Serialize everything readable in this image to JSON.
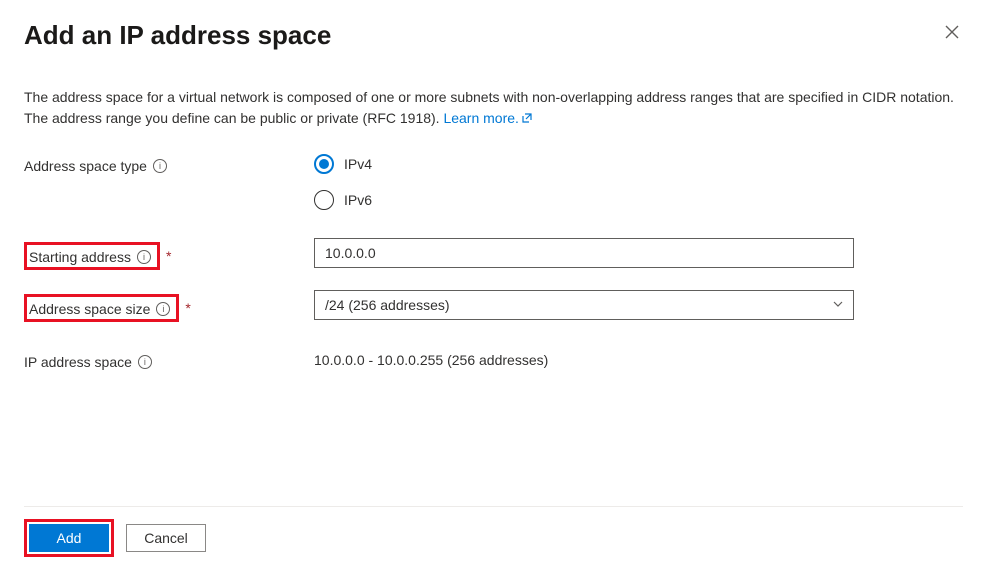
{
  "header": {
    "title": "Add an IP address space"
  },
  "description": {
    "text": "The address space for a virtual network is composed of one or more subnets with non-overlapping address ranges that are specified in CIDR notation. The address range you define can be public or private (RFC 1918). ",
    "learn_more": "Learn more."
  },
  "fields": {
    "address_space_type": {
      "label": "Address space type",
      "options": {
        "ipv4": "IPv4",
        "ipv6": "IPv6"
      },
      "selected": "ipv4"
    },
    "starting_address": {
      "label": "Starting address",
      "value": "10.0.0.0"
    },
    "address_space_size": {
      "label": "Address space size",
      "value": "/24 (256 addresses)"
    },
    "ip_address_space": {
      "label": "IP address space",
      "value": "10.0.0.0 - 10.0.0.255 (256 addresses)"
    }
  },
  "footer": {
    "add": "Add",
    "cancel": "Cancel"
  }
}
